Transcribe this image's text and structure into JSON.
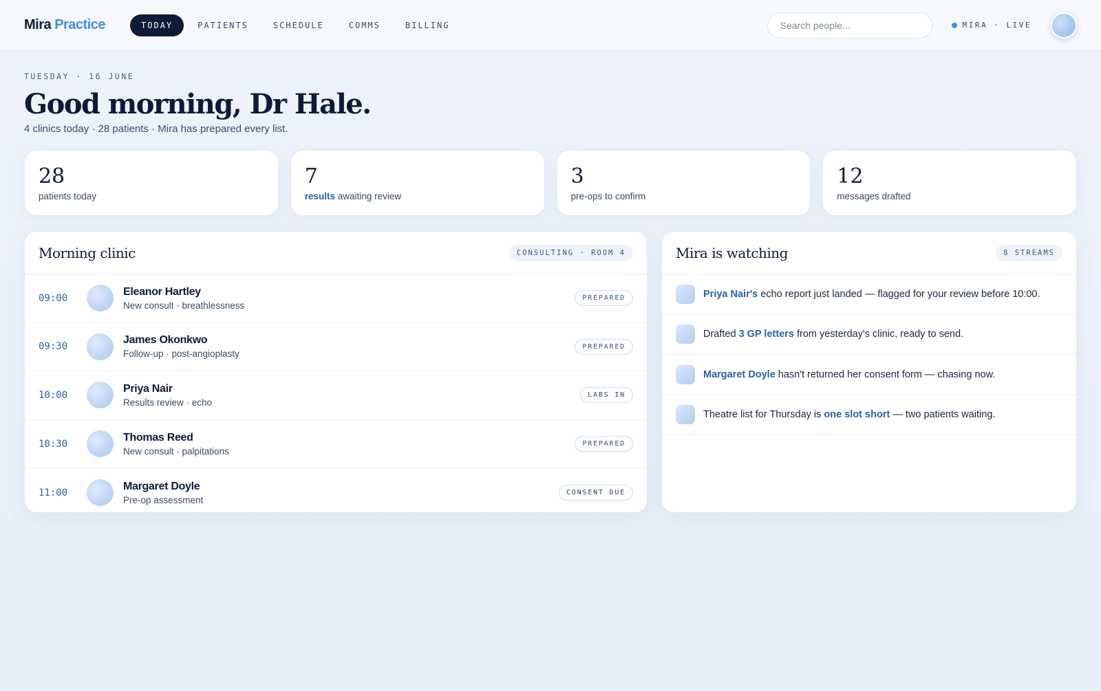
{
  "brand": {
    "name_part1": "Mira",
    "name_part2": "Practice"
  },
  "nav": [
    {
      "label": "TODAY",
      "active": true
    },
    {
      "label": "PATIENTS",
      "active": false
    },
    {
      "label": "SCHEDULE",
      "active": false
    },
    {
      "label": "COMMS",
      "active": false
    },
    {
      "label": "BILLING",
      "active": false
    }
  ],
  "search": {
    "placeholder": "Search people...",
    "value": ""
  },
  "status": {
    "text": "MIRA · LIVE"
  },
  "header": {
    "date": "TUESDAY · 16 JUNE",
    "greeting": "Good morning, Dr Hale.",
    "subtitle": "4 clinics today · 28 patients · Mira has prepared every list."
  },
  "stats": [
    {
      "value": "28",
      "label_strong": "",
      "label": "patients today"
    },
    {
      "value": "7",
      "label_strong": "results",
      "label": " awaiting review"
    },
    {
      "value": "3",
      "label_strong": "",
      "label": "pre-ops to confirm"
    },
    {
      "value": "12",
      "label_strong": "",
      "label": "messages drafted"
    }
  ],
  "clinic": {
    "title": "Morning clinic",
    "badge": "CONSULTING · ROOM 4",
    "rows": [
      {
        "time": "09:00",
        "name": "Eleanor Hartley",
        "desc": "New consult · breathlessness",
        "tag": "PREPARED"
      },
      {
        "time": "09:30",
        "name": "James Okonkwo",
        "desc": "Follow-up · post-angioplasty",
        "tag": "PREPARED"
      },
      {
        "time": "10:00",
        "name": "Priya Nair",
        "desc": "Results review · echo",
        "tag": "LABS IN"
      },
      {
        "time": "10:30",
        "name": "Thomas Reed",
        "desc": "New consult · palpitations",
        "tag": "PREPARED"
      },
      {
        "time": "11:00",
        "name": "Margaret Doyle",
        "desc": "Pre-op assessment",
        "tag": "CONSENT DUE"
      }
    ]
  },
  "watch": {
    "title": "Mira is watching",
    "badge": "8 STREAMS",
    "items": [
      {
        "pre": "",
        "highlight": "Priya Nair's",
        "post": " echo report just landed — flagged for your review before 10:00."
      },
      {
        "pre": "Drafted ",
        "highlight": "3 GP letters",
        "post": " from yesterday's clinic, ready to send."
      },
      {
        "pre": "",
        "highlight": "Margaret Doyle",
        "post": " hasn't returned her consent form — chasing now."
      },
      {
        "pre": "Theatre list for Thursday is ",
        "highlight": "one slot short",
        "post": " — two patients waiting."
      }
    ]
  },
  "colors": {
    "accent": "#4a8be0",
    "navy": "#0d1b38",
    "link": "#2b5fa6"
  }
}
